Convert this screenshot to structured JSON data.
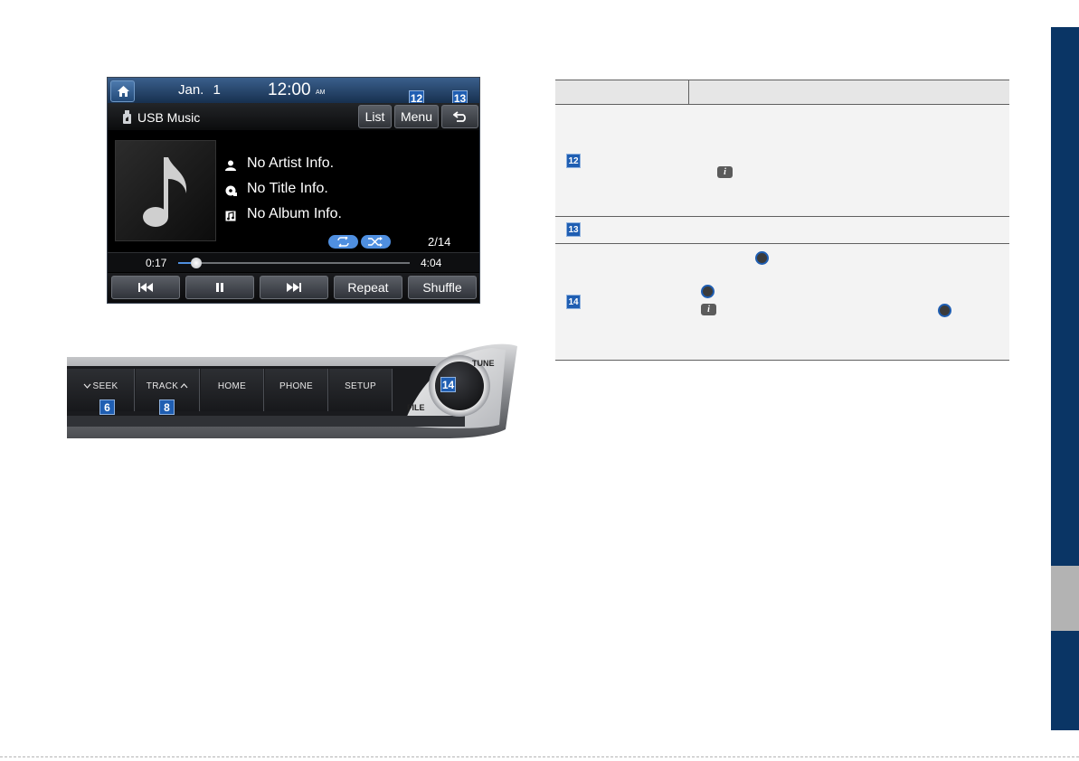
{
  "screen": {
    "date": "Jan.  1",
    "time": "12:00",
    "ampm": "AM",
    "source_label": "USB Music",
    "buttons": {
      "list": "List",
      "menu": "Menu"
    },
    "track_info": {
      "artist": "No Artist Info.",
      "title": "No Title Info.",
      "album": "No Album Info."
    },
    "track_count": "2/14",
    "elapsed": "0:17",
    "duration": "4:04",
    "progress_fraction": 0.08,
    "controls": {
      "repeat": "Repeat",
      "shuffle": "Shuffle"
    },
    "accent_color": "#4f8fe0"
  },
  "callouts": {
    "menu": "12",
    "back": "13",
    "seek": "6",
    "track": "8",
    "knob": "14"
  },
  "panel": {
    "buttons": {
      "seek": "SEEK",
      "track": "TRACK",
      "home": "HOME",
      "phone": "PHONE",
      "setup": "SETUP"
    },
    "tune_label": "TUNE",
    "file_label": "FILE"
  },
  "table": {
    "rows": [
      {
        "callout": "12"
      },
      {
        "callout": "13"
      },
      {
        "callout": "14"
      }
    ]
  },
  "colors": {
    "side_tab": "#0a3565",
    "callout_blue": "#1f5eb2"
  }
}
